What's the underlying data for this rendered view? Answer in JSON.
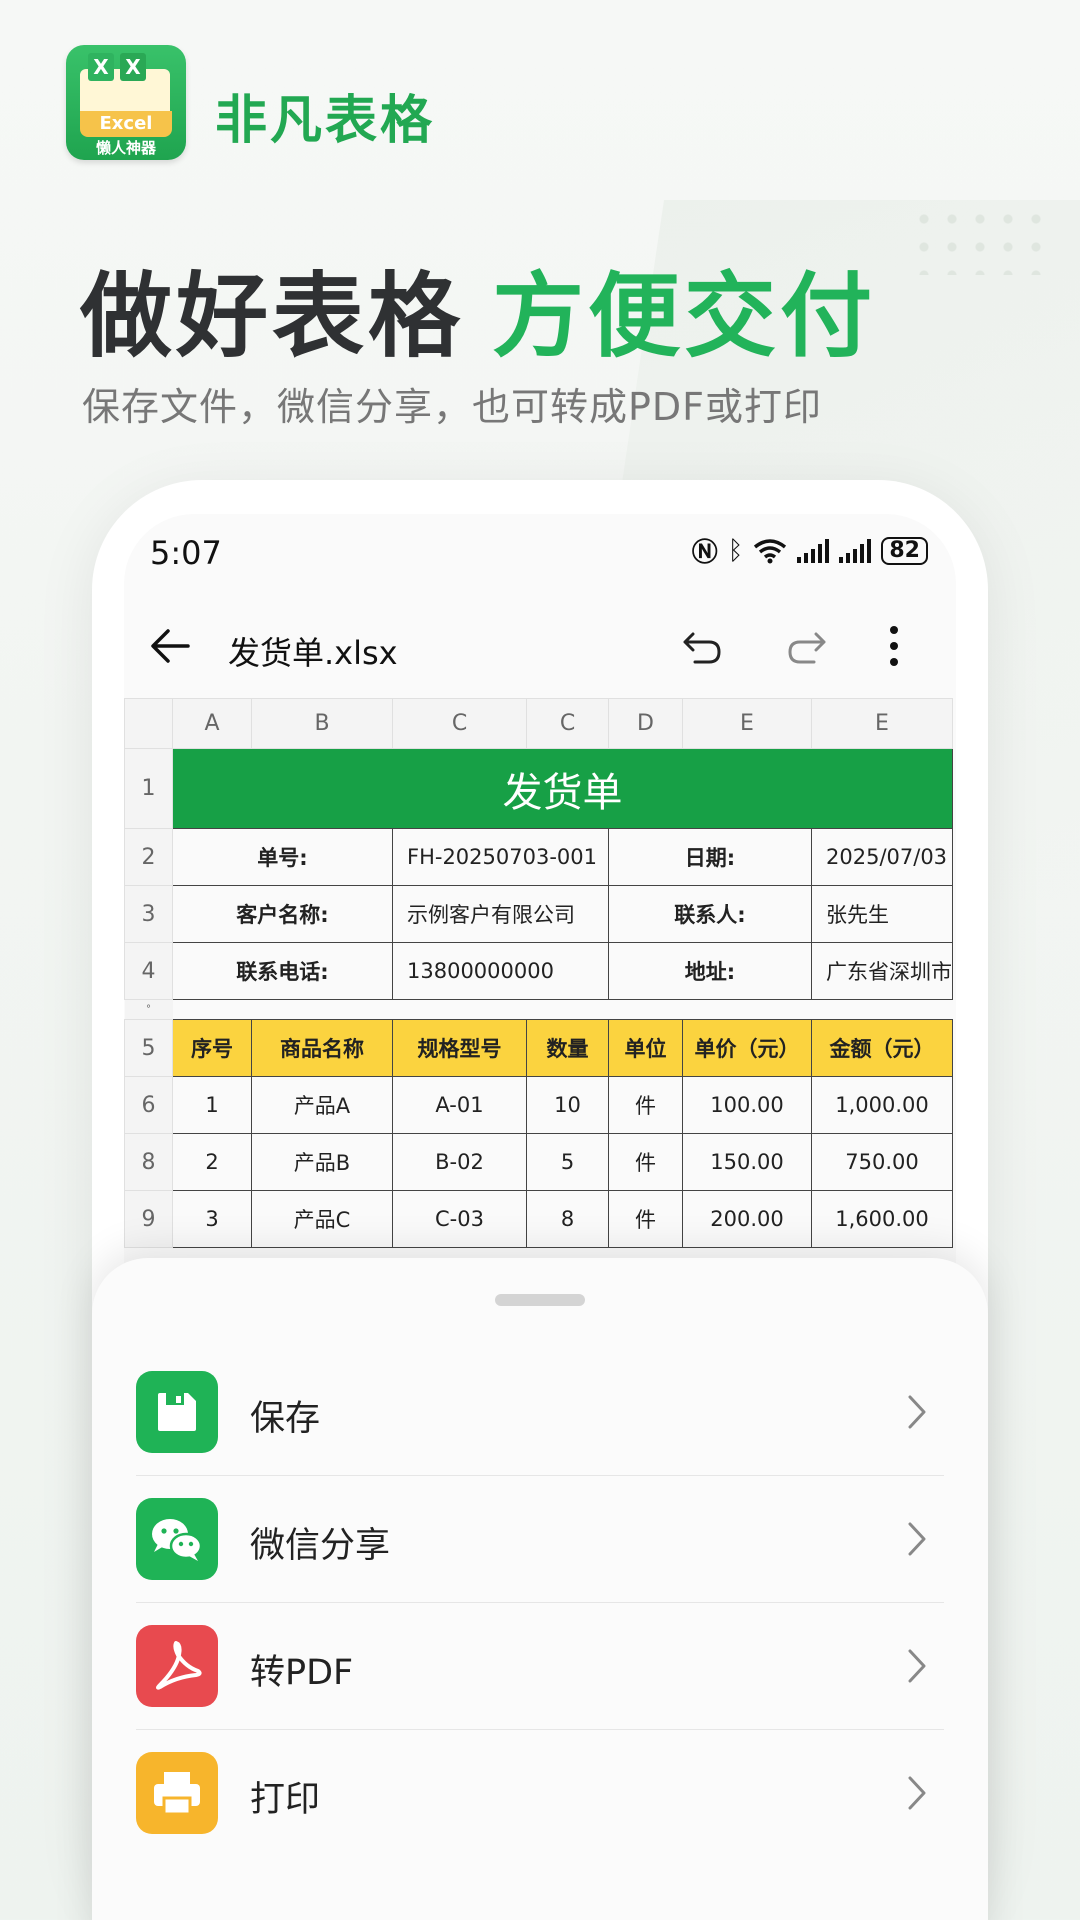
{
  "brand": {
    "logo_text": "Excel",
    "logo_letters": [
      "X",
      "X"
    ],
    "logo_subtitle": "懒人神器",
    "name": "非凡表格"
  },
  "hero": {
    "headline_dark": "做好表格",
    "headline_green": "方便交付",
    "subline": "保存文件，微信分享，也可转成PDF或打印"
  },
  "status_bar": {
    "time": "5:07",
    "battery": "82"
  },
  "toolbar": {
    "file_name": "发货单.xlsx"
  },
  "sheet": {
    "column_headers": [
      "A",
      "B",
      "C",
      "C",
      "D",
      "E",
      "E"
    ],
    "title": "发货单",
    "info_rows": [
      {
        "row": "2",
        "label1": "单号:",
        "value1": "FH-20250703-001",
        "label2": "日期:",
        "value2": "2025/07/03"
      },
      {
        "row": "3",
        "label1": "客户名称:",
        "value1": "示例客户有限公司",
        "label2": "联系人:",
        "value2": "张先生"
      },
      {
        "row": "4",
        "label1": "联系电话:",
        "value1": "13800000000",
        "label2": "地址:",
        "value2": "广东省深圳市南山区"
      }
    ],
    "gap_row_label": "°",
    "item_header_row": "5",
    "item_headers": [
      "序号",
      "商品名称",
      "规格型号",
      "数量",
      "单位",
      "单价（元）",
      "金额（元）"
    ],
    "item_rows": [
      {
        "row": "6",
        "cells": [
          "1",
          "产品A",
          "A-01",
          "10",
          "件",
          "100.00",
          "1,000.00"
        ]
      },
      {
        "row": "8",
        "cells": [
          "2",
          "产品B",
          "B-02",
          "5",
          "件",
          "150.00",
          "750.00"
        ]
      },
      {
        "row": "9",
        "cells": [
          "3",
          "产品C",
          "C-03",
          "8",
          "件",
          "200.00",
          "1,600.00"
        ]
      }
    ],
    "title_row": "1"
  },
  "actions": [
    {
      "label": "保存",
      "icon": "save-icon",
      "color": "#1fb356"
    },
    {
      "label": "微信分享",
      "icon": "wechat-icon",
      "color": "#1fb356"
    },
    {
      "label": "转PDF",
      "icon": "pdf-icon",
      "color": "#e84a4f"
    },
    {
      "label": "打印",
      "icon": "print-icon",
      "color": "#f7b52c"
    }
  ],
  "colors": {
    "brand_green": "#22b35a",
    "title_row_green": "#17a046",
    "header_yellow": "#fbd33f"
  }
}
